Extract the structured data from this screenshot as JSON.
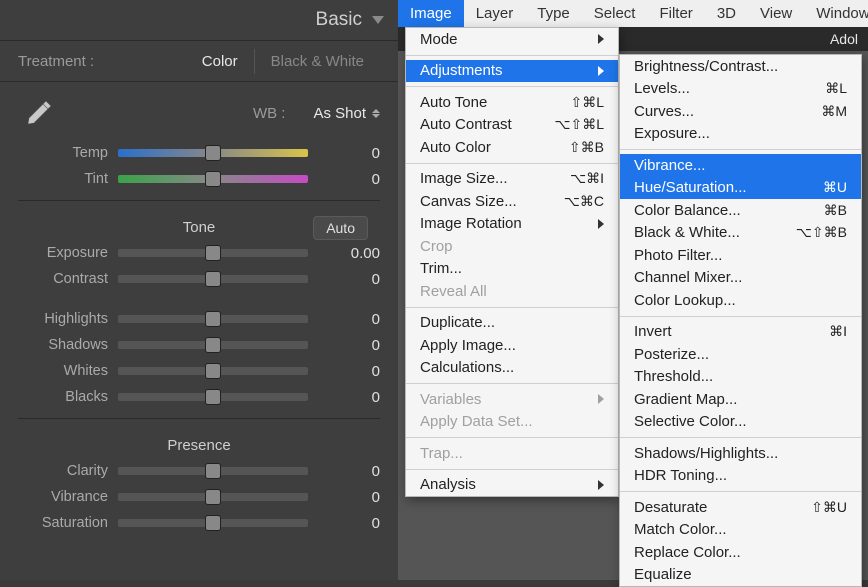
{
  "left": {
    "panel_title": "Basic",
    "treatment_label": "Treatment :",
    "treatment_color": "Color",
    "treatment_bw": "Black & White",
    "wb_label": "WB :",
    "wb_value": "As Shot",
    "sliders": {
      "temp": {
        "label": "Temp",
        "value": "0"
      },
      "tint": {
        "label": "Tint",
        "value": "0"
      },
      "exposure": {
        "label": "Exposure",
        "value": "0.00"
      },
      "contrast": {
        "label": "Contrast",
        "value": "0"
      },
      "highlights": {
        "label": "Highlights",
        "value": "0"
      },
      "shadows": {
        "label": "Shadows",
        "value": "0"
      },
      "whites": {
        "label": "Whites",
        "value": "0"
      },
      "blacks": {
        "label": "Blacks",
        "value": "0"
      },
      "clarity": {
        "label": "Clarity",
        "value": "0"
      },
      "vibrance": {
        "label": "Vibrance",
        "value": "0"
      },
      "saturation": {
        "label": "Saturation",
        "value": "0"
      }
    },
    "tone_title": "Tone",
    "auto_label": "Auto",
    "presence_title": "Presence"
  },
  "menubar": {
    "image": "Image",
    "layer": "Layer",
    "type": "Type",
    "select": "Select",
    "filter": "Filter",
    "threeD": "3D",
    "view": "View",
    "window": "Window"
  },
  "app_bar": "Adol",
  "image_menu": {
    "mode": "Mode",
    "adjustments": "Adjustments",
    "auto_tone": {
      "label": "Auto Tone",
      "shortcut": "⇧⌘L"
    },
    "auto_contrast": {
      "label": "Auto Contrast",
      "shortcut": "⌥⇧⌘L"
    },
    "auto_color": {
      "label": "Auto Color",
      "shortcut": "⇧⌘B"
    },
    "image_size": {
      "label": "Image Size...",
      "shortcut": "⌥⌘I"
    },
    "canvas_size": {
      "label": "Canvas Size...",
      "shortcut": "⌥⌘C"
    },
    "image_rotation": "Image Rotation",
    "crop": "Crop",
    "trim": "Trim...",
    "reveal_all": "Reveal All",
    "duplicate": "Duplicate...",
    "apply_image": "Apply Image...",
    "calculations": "Calculations...",
    "variables": "Variables",
    "apply_data_set": "Apply Data Set...",
    "trap": "Trap...",
    "analysis": "Analysis"
  },
  "adjustments_menu": {
    "brightness": "Brightness/Contrast...",
    "levels": {
      "label": "Levels...",
      "shortcut": "⌘L"
    },
    "curves": {
      "label": "Curves...",
      "shortcut": "⌘M"
    },
    "exposure": "Exposure...",
    "vibrance": "Vibrance...",
    "hue_sat": {
      "label": "Hue/Saturation...",
      "shortcut": "⌘U"
    },
    "color_balance": {
      "label": "Color Balance...",
      "shortcut": "⌘B"
    },
    "black_white": {
      "label": "Black & White...",
      "shortcut": "⌥⇧⌘B"
    },
    "photo_filter": "Photo Filter...",
    "channel_mixer": "Channel Mixer...",
    "color_lookup": "Color Lookup...",
    "invert": {
      "label": "Invert",
      "shortcut": "⌘I"
    },
    "posterize": "Posterize...",
    "threshold": "Threshold...",
    "gradient_map": "Gradient Map...",
    "selective_color": "Selective Color...",
    "shadows_highlights": "Shadows/Highlights...",
    "hdr_toning": "HDR Toning...",
    "desaturate": {
      "label": "Desaturate",
      "shortcut": "⇧⌘U"
    },
    "match_color": "Match Color...",
    "replace_color": "Replace Color...",
    "equalize": "Equalize"
  }
}
